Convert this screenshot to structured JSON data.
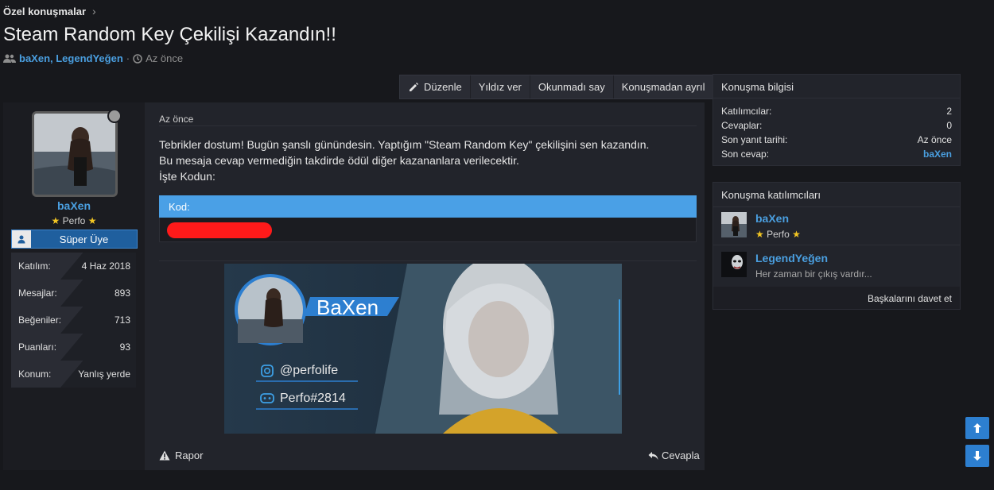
{
  "breadcrumb": {
    "label": "Özel konuşmalar",
    "chevron": "›"
  },
  "title": "Steam Random Key Çekilişi Kazandın!!",
  "meta": {
    "users_icon": "users-icon",
    "users": "baXen, LegendYeğen",
    "separator": "·",
    "clock_icon": "clock-icon",
    "time": "Az önce"
  },
  "actions": {
    "edit": "Düzenle",
    "star": "Yıldız ver",
    "unread": "Okunmadı say",
    "leave": "Konuşmadan ayrıl"
  },
  "author": {
    "name": "baXen",
    "title": "Perfo",
    "rank": "Süper Üye",
    "stats": [
      {
        "k": "Katılım:",
        "v": "4 Haz 2018"
      },
      {
        "k": "Mesajlar:",
        "v": "893"
      },
      {
        "k": "Beğeniler:",
        "v": "713"
      },
      {
        "k": "Puanları:",
        "v": "93"
      },
      {
        "k": "Konum:",
        "v": "Yanlış yerde"
      }
    ]
  },
  "message": {
    "time": "Az önce",
    "line1": "Tebrikler dostum! Bugün şanslı günündesin. Yaptığım \"Steam Random Key\" çekilişini sen kazandın.",
    "line2": "Bu mesaja cevap vermediğin takdirde ödül diğer kazananlara verilecektir.",
    "line3": "İşte Kodun:",
    "code_label": "Kod:",
    "report": "Rapor",
    "reply": "Cevapla"
  },
  "banner": {
    "name": "BaXen",
    "instagram": "@perfolife",
    "discord": "Perfo#2814"
  },
  "conv_info": {
    "title": "Konuşma bilgisi",
    "rows": [
      {
        "k": "Katılımcılar:",
        "v": "2"
      },
      {
        "k": "Cevaplar:",
        "v": "0"
      },
      {
        "k": "Son yanıt tarihi:",
        "v": "Az önce"
      },
      {
        "k": "Son cevap:",
        "v": "baXen"
      }
    ]
  },
  "participants": {
    "title": "Konuşma katılımcıları",
    "list": [
      {
        "name": "baXen",
        "sub": "Perfo"
      },
      {
        "name": "LegendYeğen",
        "sub": "Her zaman bir çıkış vardır..."
      }
    ],
    "invite": "Başkalarını davet et"
  }
}
